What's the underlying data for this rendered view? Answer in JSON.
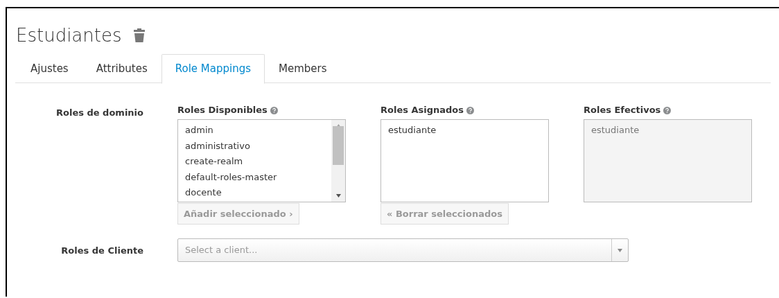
{
  "title": "Estudiantes",
  "tabs": [
    {
      "label": "Ajustes",
      "selected": false
    },
    {
      "label": "Attributes",
      "selected": false
    },
    {
      "label": "Role Mappings",
      "selected": true
    },
    {
      "label": "Members",
      "selected": false
    }
  ],
  "realm_roles": {
    "label": "Roles de dominio",
    "lists": [
      {
        "heading": "Roles Disponibles",
        "items": [
          "admin",
          "administrativo",
          "create-realm",
          "default-roles-master",
          "docente"
        ],
        "disabled": false,
        "scrollable": true,
        "button": {
          "label": "Añadir seleccionado ›",
          "disabled": true
        }
      },
      {
        "heading": "Roles Asignados",
        "items": [
          "estudiante"
        ],
        "disabled": false,
        "scrollable": false,
        "button": {
          "label": "« Borrar seleccionados",
          "disabled": true
        }
      },
      {
        "heading": "Roles Efectivos",
        "items": [
          "estudiante"
        ],
        "disabled": true,
        "scrollable": false
      }
    ]
  },
  "client_roles": {
    "label": "Roles de Cliente",
    "placeholder": "Select a client..."
  }
}
